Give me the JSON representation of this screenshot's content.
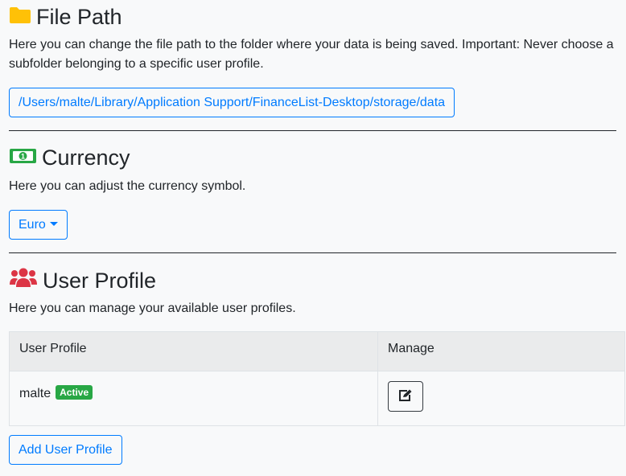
{
  "file_path": {
    "title": "File Path",
    "icon": "folder-icon",
    "description": "Here you can change the file path to the folder where your data is being saved. Important: Never choose a subfolder belonging to a specific user profile.",
    "path_button": "/Users/malte/Library/Application Support/FinanceList-Desktop/storage/data"
  },
  "currency": {
    "title": "Currency",
    "icon": "money-bill-icon",
    "description": "Here you can adjust the currency symbol.",
    "selected": "Euro"
  },
  "user_profile": {
    "title": "User Profile",
    "icon": "users-icon",
    "description": "Here you can manage your available user profiles.",
    "table": {
      "headers": [
        "User Profile",
        "Manage"
      ],
      "rows": [
        {
          "name": "malte",
          "badge": "Active",
          "manage_icon": "edit-icon"
        }
      ]
    },
    "add_button": "Add User Profile"
  },
  "colors": {
    "folder": "#ffc107",
    "currency": "#28a745",
    "users": "#dc3545",
    "primary": "#007bff",
    "badge": "#28a745"
  }
}
